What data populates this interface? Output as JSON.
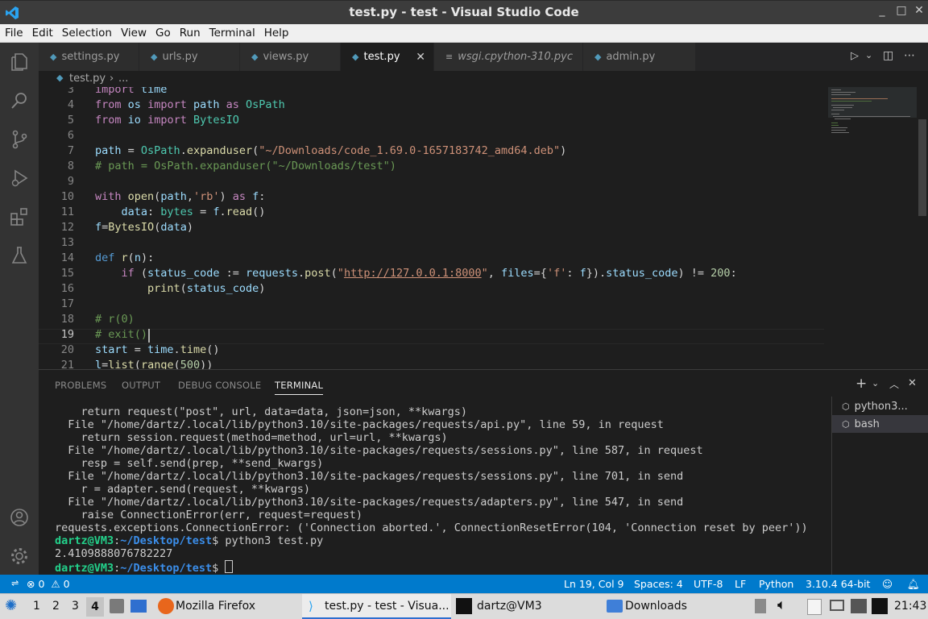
{
  "window": {
    "title": "test.py - test - Visual Studio Code"
  },
  "menu": [
    "File",
    "Edit",
    "Selection",
    "View",
    "Go",
    "Run",
    "Terminal",
    "Help"
  ],
  "tabs": [
    {
      "label": "settings.py"
    },
    {
      "label": "urls.py"
    },
    {
      "label": "views.py"
    },
    {
      "label": "test.py",
      "active": true
    },
    {
      "label": "wsgi.cpython-310.pyc",
      "italic": true
    },
    {
      "label": "admin.py"
    }
  ],
  "breadcrumb": {
    "file": "test.py",
    "rest": "..."
  },
  "editor": {
    "line_numbers": [
      "3",
      "4",
      "5",
      "6",
      "7",
      "8",
      "9",
      "10",
      "11",
      "12",
      "13",
      "14",
      "15",
      "16",
      "17",
      "18",
      "19",
      "20",
      "21"
    ],
    "current_line": "19",
    "lines": [
      "import time",
      "from os import path as OsPath",
      "from io import BytesIO",
      "",
      "path = OsPath.expanduser(\"~/Downloads/code_1.69.0-1657183742_amd64.deb\")",
      "# path = OsPath.expanduser(\"~/Downloads/test\")",
      "",
      "with open(path,'rb') as f:",
      "    data: bytes = f.read()",
      "f=BytesIO(data)",
      "",
      "def r(n):",
      "    if (status_code := requests.post(\"http://127.0.0.1:8000\", files={'f': f}).status_code) != 200:",
      "        print(status_code)",
      "",
      "# r(0)",
      "# exit()",
      "start = time.time()",
      "l=list(range(500))"
    ]
  },
  "panel": {
    "tabs": [
      "PROBLEMS",
      "OUTPUT",
      "DEBUG CONSOLE",
      "TERMINAL"
    ],
    "active_tab": "TERMINAL",
    "terminals": [
      "python3...",
      "bash"
    ],
    "terminal_lines": [
      "    return request(\"post\", url, data=data, json=json, **kwargs)",
      "  File \"/home/dartz/.local/lib/python3.10/site-packages/requests/api.py\", line 59, in request",
      "    return session.request(method=method, url=url, **kwargs)",
      "  File \"/home/dartz/.local/lib/python3.10/site-packages/requests/sessions.py\", line 587, in request",
      "    resp = self.send(prep, **send_kwargs)",
      "  File \"/home/dartz/.local/lib/python3.10/site-packages/requests/sessions.py\", line 701, in send",
      "    r = adapter.send(request, **kwargs)",
      "  File \"/home/dartz/.local/lib/python3.10/site-packages/requests/adapters.py\", line 547, in send",
      "    raise ConnectionError(err, request=request)",
      "requests.exceptions.ConnectionError: ('Connection aborted.', ConnectionResetError(104, 'Connection reset by peer'))"
    ],
    "prompt_user": "dartz@VM3",
    "prompt_path": "~/Desktop/test",
    "command": " python3 test.py",
    "output": "2.4109888076782227"
  },
  "statusbar": {
    "errors": "0",
    "warnings": "0",
    "position": "Ln 19, Col 9",
    "spaces": "Spaces: 4",
    "encoding": "UTF-8",
    "eol": "LF",
    "language": "Python",
    "interpreter": "3.10.4 64-bit"
  },
  "taskbar": {
    "workspaces": [
      "1",
      "2",
      "3",
      "4"
    ],
    "active_workspace": "4",
    "apps": [
      {
        "label": "Mozilla Firefox"
      },
      {
        "label": "test.py - test - Visua..."
      },
      {
        "label": "dartz@VM3"
      },
      {
        "label": "Downloads"
      }
    ],
    "clock": "21:43"
  },
  "colors": {
    "accent": "#007acc",
    "titlebar": "#3c3c3c",
    "editor_bg": "#1e1e1e",
    "activity_bar": "#333333"
  }
}
